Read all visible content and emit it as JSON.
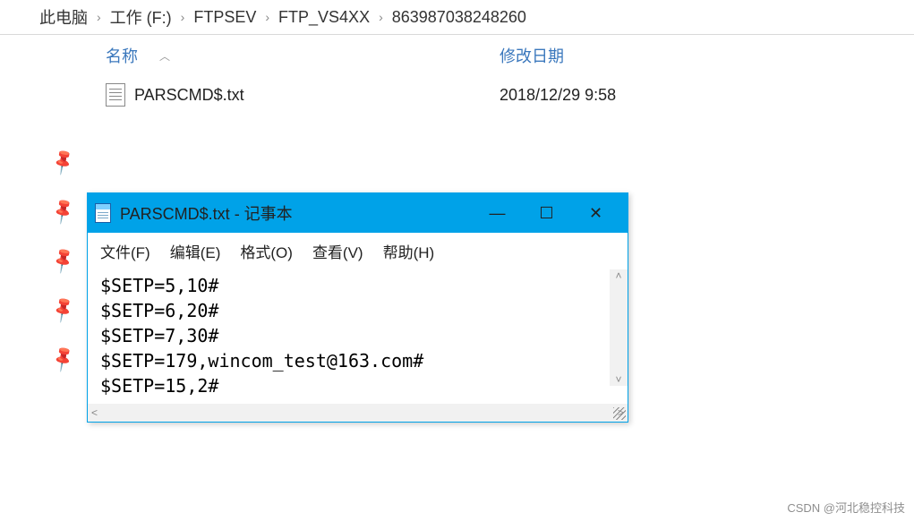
{
  "breadcrumb": {
    "items": [
      "此电脑",
      "工作 (F:)",
      "FTPSEV",
      "FTP_VS4XX",
      "863987038248260"
    ]
  },
  "columns": {
    "name": "名称",
    "modified": "修改日期"
  },
  "file": {
    "name": "PARSCMD$.txt",
    "modified": "2018/12/29 9:58"
  },
  "notepad": {
    "title": "PARSCMD$.txt - 记事本",
    "menu": {
      "file": "文件(F)",
      "edit": "编辑(E)",
      "format": "格式(O)",
      "view": "查看(V)",
      "help": "帮助(H)"
    },
    "content": "$SETP=5,10#\n$SETP=6,20#\n$SETP=7,30#\n$SETP=179,wincom_test@163.com#\n$SETP=15,2#"
  },
  "watermark": "CSDN @河北稳控科技"
}
